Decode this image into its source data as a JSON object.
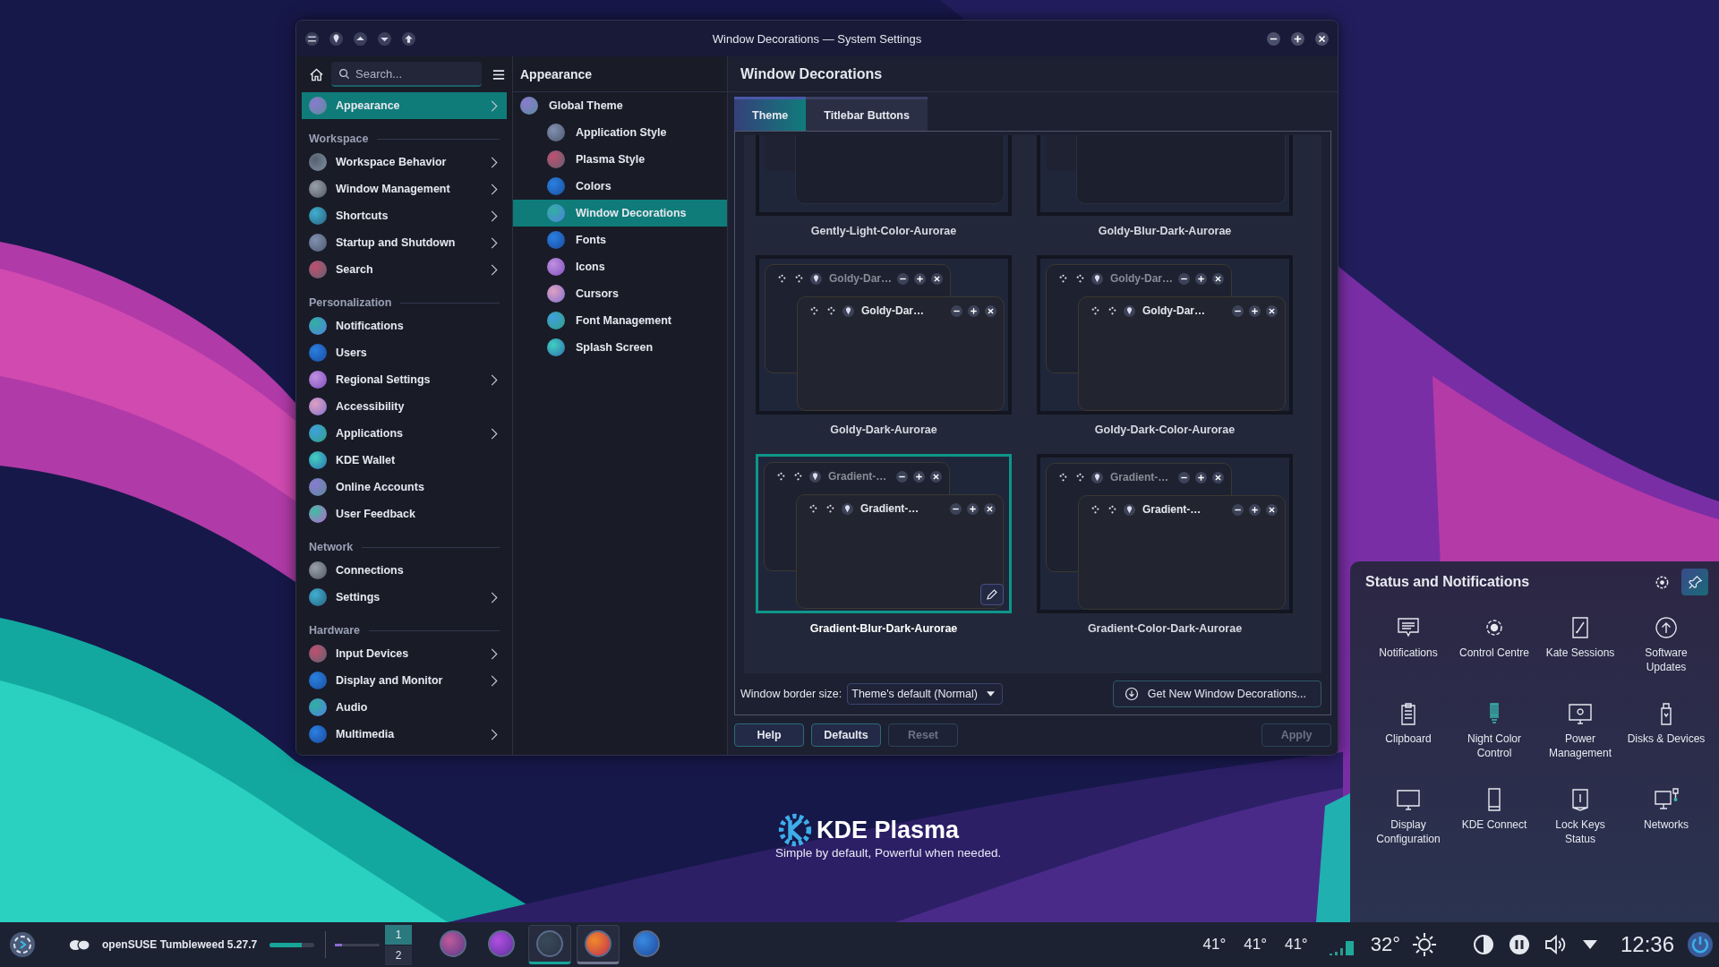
{
  "desktop": {
    "brand": "KDE Plasma",
    "tagline": "Simple by default, Powerful when needed."
  },
  "window": {
    "title": "Window Decorations — System Settings"
  },
  "sidebar": {
    "search_placeholder": "Search...",
    "entries": [
      {
        "kind": "item",
        "label": "Appearance",
        "selected": true,
        "expandable": true
      },
      {
        "kind": "header",
        "label": "Workspace"
      },
      {
        "kind": "item",
        "label": "Workspace Behavior",
        "selected": false,
        "expandable": true
      },
      {
        "kind": "item",
        "label": "Window Management",
        "selected": false,
        "expandable": true
      },
      {
        "kind": "item",
        "label": "Shortcuts",
        "selected": false,
        "expandable": true
      },
      {
        "kind": "item",
        "label": "Startup and Shutdown",
        "selected": false,
        "expandable": true
      },
      {
        "kind": "item",
        "label": "Search",
        "selected": false,
        "expandable": true
      },
      {
        "kind": "header",
        "label": "Personalization"
      },
      {
        "kind": "item",
        "label": "Notifications",
        "selected": false,
        "expandable": false
      },
      {
        "kind": "item",
        "label": "Users",
        "selected": false,
        "expandable": false
      },
      {
        "kind": "item",
        "label": "Regional Settings",
        "selected": false,
        "expandable": true
      },
      {
        "kind": "item",
        "label": "Accessibility",
        "selected": false,
        "expandable": false
      },
      {
        "kind": "item",
        "label": "Applications",
        "selected": false,
        "expandable": true
      },
      {
        "kind": "item",
        "label": "KDE Wallet",
        "selected": false,
        "expandable": false
      },
      {
        "kind": "item",
        "label": "Online Accounts",
        "selected": false,
        "expandable": false
      },
      {
        "kind": "item",
        "label": "User Feedback",
        "selected": false,
        "expandable": false
      },
      {
        "kind": "header",
        "label": "Network"
      },
      {
        "kind": "item",
        "label": "Connections",
        "selected": false,
        "expandable": false
      },
      {
        "kind": "item",
        "label": "Settings",
        "selected": false,
        "expandable": true
      },
      {
        "kind": "header",
        "label": "Hardware"
      },
      {
        "kind": "item",
        "label": "Input Devices",
        "selected": false,
        "expandable": true
      },
      {
        "kind": "item",
        "label": "Display and Monitor",
        "selected": false,
        "expandable": true
      },
      {
        "kind": "item",
        "label": "Audio",
        "selected": false,
        "expandable": false
      },
      {
        "kind": "item",
        "label": "Multimedia",
        "selected": false,
        "expandable": true
      }
    ]
  },
  "subnav": {
    "title": "Appearance",
    "items": [
      {
        "label": "Global Theme",
        "selected": false,
        "children": [
          {
            "label": "Application Style",
            "selected": false
          },
          {
            "label": "Plasma Style",
            "selected": false
          },
          {
            "label": "Colors",
            "selected": false
          },
          {
            "label": "Window Decorations",
            "selected": true
          },
          {
            "label": "Fonts",
            "selected": false
          },
          {
            "label": "Icons",
            "selected": false
          },
          {
            "label": "Cursors",
            "selected": false
          },
          {
            "label": "Font Management",
            "selected": false
          },
          {
            "label": "Splash Screen",
            "selected": false
          }
        ]
      }
    ]
  },
  "content": {
    "title": "Window Decorations",
    "tabs": [
      {
        "label": "Theme",
        "selected": true
      },
      {
        "label": "Titlebar Buttons",
        "selected": false
      }
    ],
    "themes": [
      {
        "name": "Gently-Light-Color-Aurorae",
        "kind": "cut",
        "selected": false
      },
      {
        "name": "Goldy-Blur-Dark-Aurorae",
        "kind": "cut",
        "selected": false
      },
      {
        "name": "Goldy-Dark-Aurorae",
        "kind": "preview",
        "selected": false,
        "preview_titles": [
          "Goldy-Dar…",
          "Goldy-Dar…"
        ]
      },
      {
        "name": "Goldy-Dark-Color-Aurorae",
        "kind": "preview",
        "selected": false,
        "preview_titles": [
          "Goldy-Dar…",
          "Goldy-Dar…"
        ]
      },
      {
        "name": "Gradient-Blur-Dark-Aurorae",
        "kind": "preview",
        "selected": true,
        "preview_titles": [
          "Gradient-…",
          "Gradient-…"
        ]
      },
      {
        "name": "Gradient-Color-Dark-Aurorae",
        "kind": "preview",
        "selected": false,
        "preview_titles": [
          "Gradient-…",
          "Gradient-…"
        ]
      }
    ],
    "border_size": {
      "label": "Window border size:",
      "value": "Theme's default (Normal)"
    },
    "get_new": "Get New Window Decorations...",
    "left_buttons": [
      {
        "label": "Help",
        "disabled": false
      },
      {
        "label": "Defaults",
        "disabled": false
      },
      {
        "label": "Reset",
        "disabled": true
      }
    ],
    "right_buttons": [
      {
        "label": "Apply",
        "disabled": true
      }
    ]
  },
  "panel": {
    "title": "Status and Notifications",
    "pinned": true,
    "items": [
      {
        "label": "Notifications"
      },
      {
        "label": "Control Centre"
      },
      {
        "label": "Kate Sessions"
      },
      {
        "label": "Software Updates"
      },
      {
        "label": "Clipboard"
      },
      {
        "label": "Night Color Control"
      },
      {
        "label": "Power Management"
      },
      {
        "label": "Disks & Devices"
      },
      {
        "label": "Display Configuration"
      },
      {
        "label": "KDE Connect"
      },
      {
        "label": "Lock Keys Status"
      },
      {
        "label": "Networks"
      }
    ]
  },
  "taskbar": {
    "title": "openSUSE Tumbleweed 5.27.7",
    "progress": {
      "level": 0.72
    },
    "slider": {
      "level": 0.15
    },
    "desktops": [
      {
        "label": "1",
        "selected": true
      },
      {
        "label": "2",
        "selected": false
      }
    ],
    "tasks": [
      {
        "active": false,
        "open": false
      },
      {
        "active": false,
        "open": false
      },
      {
        "active": true,
        "open": true
      },
      {
        "active": false,
        "open": true
      },
      {
        "active": false,
        "open": false
      }
    ],
    "temps": [
      "41°",
      "41°",
      "41°"
    ],
    "weather": "32°",
    "clock": "12:36"
  }
}
